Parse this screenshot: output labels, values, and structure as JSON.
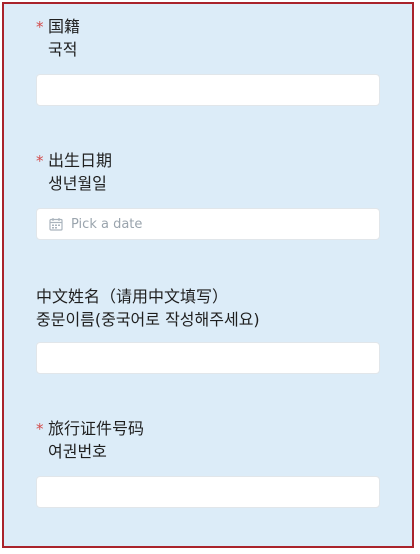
{
  "fields": [
    {
      "label_cn": "国籍",
      "label_kr": "국적",
      "required": true,
      "value": ""
    },
    {
      "label_cn": "出生日期",
      "label_kr": "생년월일",
      "required": true,
      "placeholder": "Pick a date",
      "icon": "calendar-icon"
    },
    {
      "label_cn": "中文姓名（请用中文填写）",
      "label_kr": "중문이름(중국어로 작성해주세요)",
      "required": false,
      "value": ""
    },
    {
      "label_cn": "旅行证件号码",
      "label_kr": "여권번호",
      "required": true,
      "value": ""
    }
  ],
  "required_mark": "*",
  "colors": {
    "background": "#dcecf8",
    "border": "#a9232b",
    "required": "#d24b4b"
  }
}
